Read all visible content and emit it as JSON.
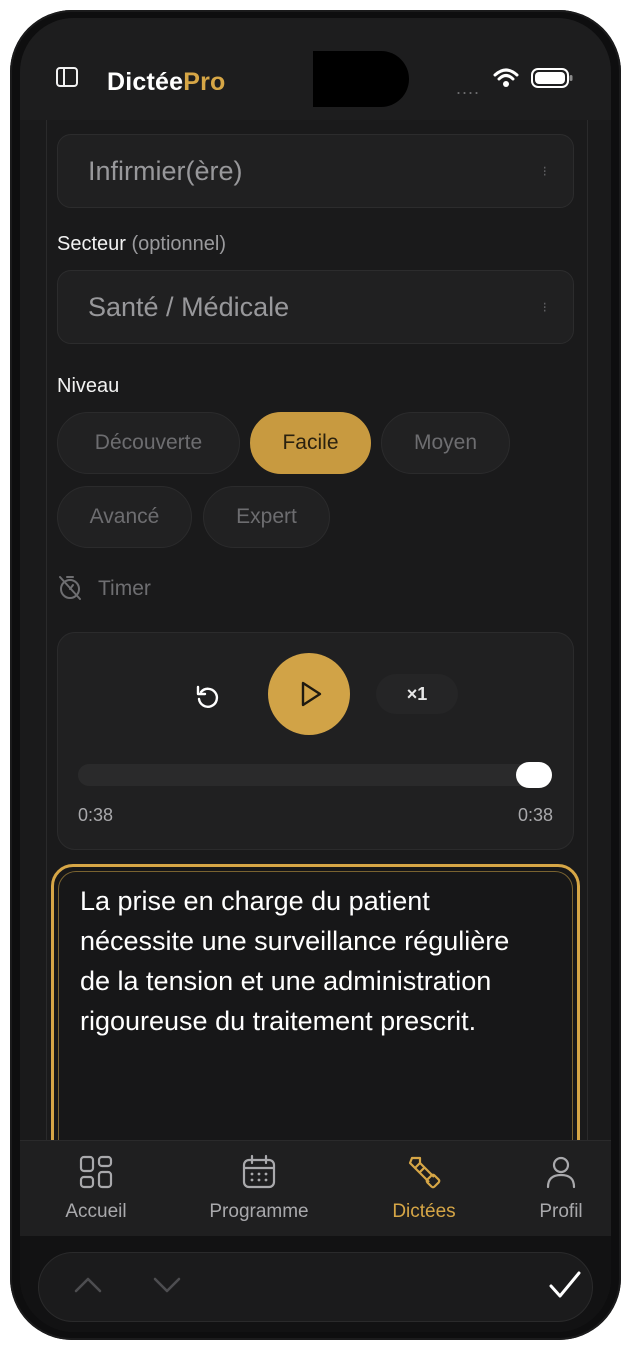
{
  "header": {
    "brand_part1": "Dictée",
    "brand_part2": "Pro",
    "signal_text": "....",
    "brand_accent_color": "#d6a646"
  },
  "form": {
    "profession_value": "Infirmier(ère)",
    "sector_label": "Secteur",
    "sector_optional": "(optionnel)",
    "sector_value": "Santé / Médicale",
    "level_label": "Niveau",
    "levels": [
      {
        "label": "Découverte",
        "active": false
      },
      {
        "label": "Facile",
        "active": true
      },
      {
        "label": "Moyen",
        "active": false
      },
      {
        "label": "Avancé",
        "active": false
      },
      {
        "label": "Expert",
        "active": false
      }
    ],
    "timer_label": "Timer",
    "select_icon": "chevron-updown-icon"
  },
  "player": {
    "speed_label": "×1",
    "time_elapsed": "0:38",
    "time_total": "0:38",
    "progress": 1.0
  },
  "dictation": {
    "text": "La prise en charge du patient nécessite une surveillance régulière de la tension et une administration rigoureuse du traitement prescrit."
  },
  "tabs": [
    {
      "label": "Accueil",
      "icon": "dashboard-icon",
      "active": false
    },
    {
      "label": "Programme",
      "icon": "calendar-icon",
      "active": false
    },
    {
      "label": "Dictées",
      "icon": "dictation-icon",
      "active": true
    },
    {
      "label": "Profil",
      "icon": "user-icon",
      "active": false
    }
  ],
  "toolbar": {
    "up_icon": "chevron-up-icon",
    "down_icon": "chevron-down-icon",
    "done_icon": "checkmark-icon"
  }
}
